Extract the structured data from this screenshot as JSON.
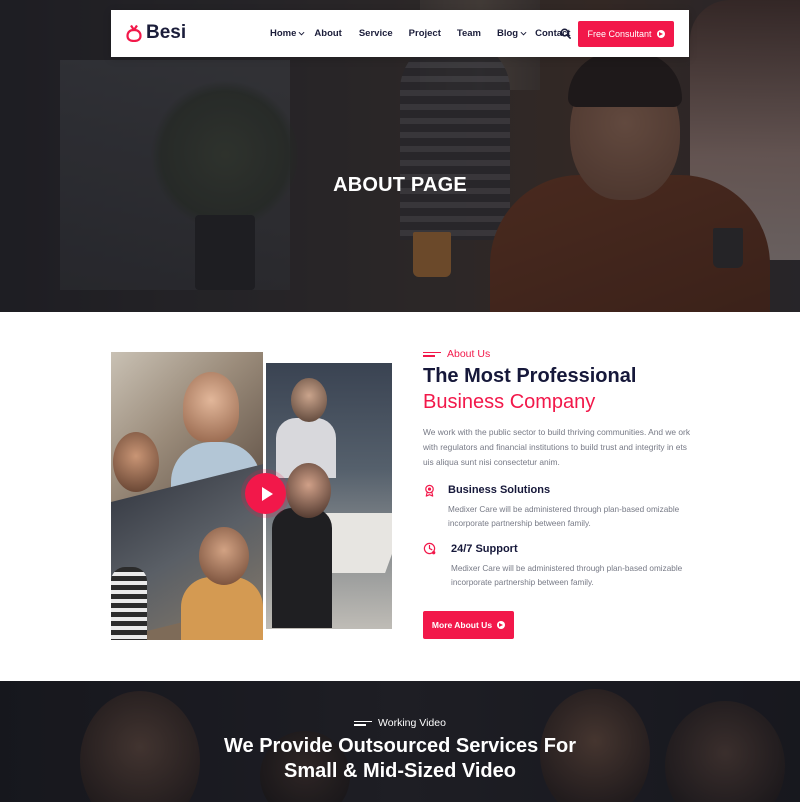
{
  "brand": {
    "name": "Besi",
    "accent": "#f2184a",
    "dark": "#16183a"
  },
  "nav": {
    "items": [
      {
        "label": "Home",
        "dropdown": true
      },
      {
        "label": "About",
        "dropdown": false
      },
      {
        "label": "Service",
        "dropdown": false
      },
      {
        "label": "Project",
        "dropdown": false
      },
      {
        "label": "Team",
        "dropdown": false
      },
      {
        "label": "Blog",
        "dropdown": true
      },
      {
        "label": "Contact",
        "dropdown": false
      }
    ],
    "search_icon": "search-icon",
    "cta_label": "Free Consultant"
  },
  "hero": {
    "title": "ABOUT PAGE"
  },
  "about": {
    "eyebrow": "About Us",
    "heading_line1": "The Most Professional",
    "heading_line2": "Business Company",
    "paragraph": "We work with the public sector to build thriving communities. And we ork with regulators and financial institutions to build trust and integrity in ets uis aliqua sunt nisi consectetur anim.",
    "features": [
      {
        "icon": "award-icon",
        "title": "Business Solutions",
        "text": "Medixer Care will be administered through plan-based omizable incorporate partnership between family."
      },
      {
        "icon": "support-icon",
        "title": "24/7 Support",
        "text": "Medixer Care will be administered through plan-based omizable incorporate partnership between family."
      }
    ],
    "button_label": "More About Us"
  },
  "video": {
    "eyebrow": "Working Video",
    "heading_line1": "We Provide Outsourced Services For",
    "heading_line2_bold": "Small &",
    "heading_line2_rest": " Mid-Sized Video"
  }
}
